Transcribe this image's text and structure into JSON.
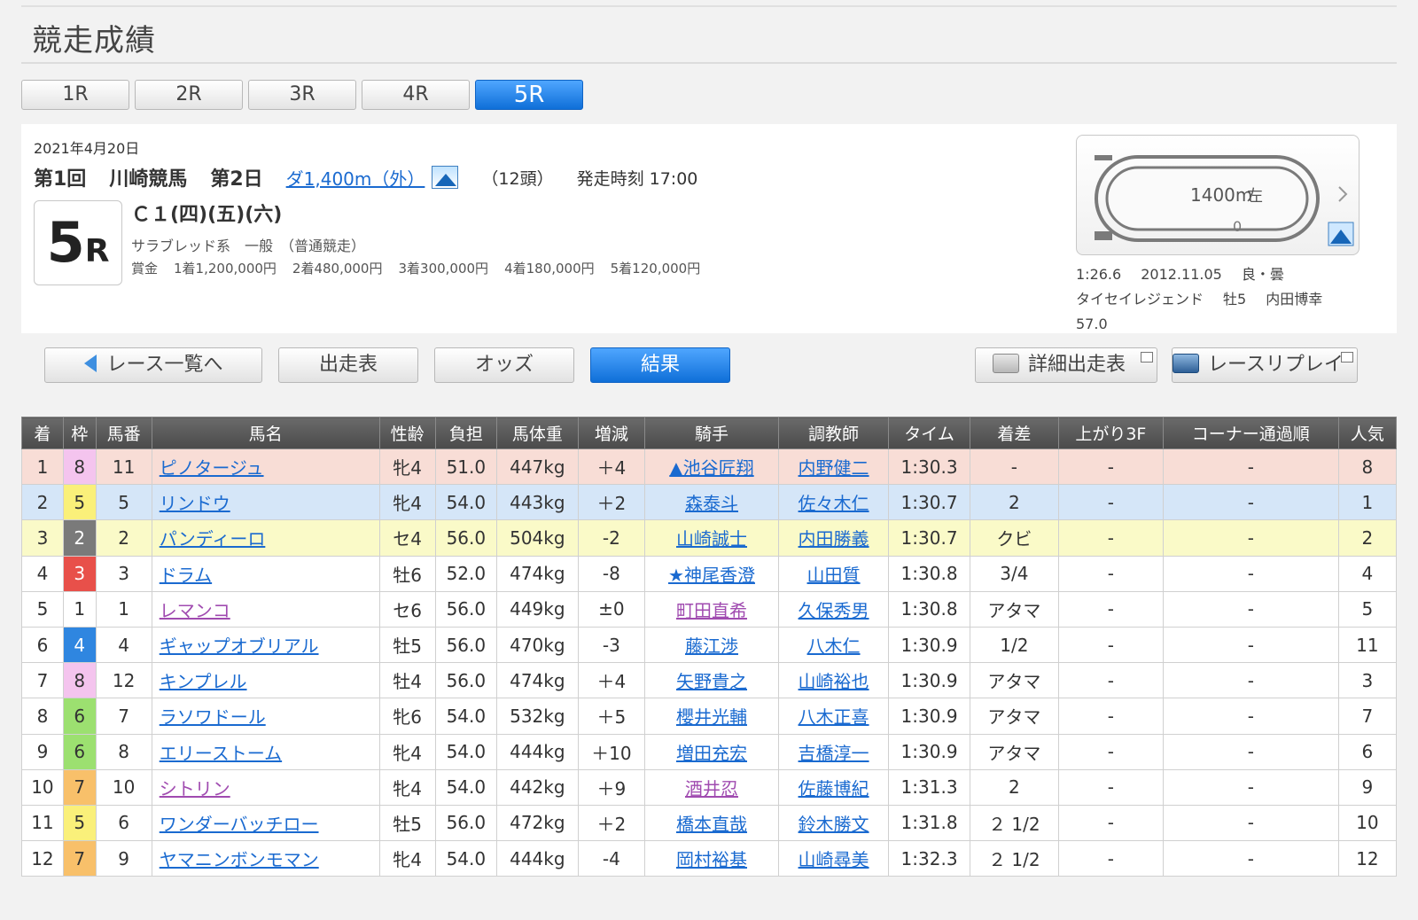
{
  "page": {
    "title": "競走成績"
  },
  "race_tabs": [
    {
      "label": "1R",
      "active": false
    },
    {
      "label": "2R",
      "active": false
    },
    {
      "label": "3R",
      "active": false
    },
    {
      "label": "4R",
      "active": false
    },
    {
      "label": "5R",
      "active": true
    }
  ],
  "race": {
    "date": "2021年4月20日",
    "kai": "第1回",
    "venue": "川崎競馬",
    "day": "第2日",
    "course": "ダ1,400m（外）",
    "heads": "（12頭）",
    "start_time": "発走時刻 17:00",
    "number": "5",
    "number_suffix": "R",
    "class": "Ｃ１(四)(五)(六)",
    "type": "サラブレッド系　一般　（普通競走）",
    "prize_label": "賞金",
    "prizes": [
      "1着1,200,000円",
      "2着480,000円",
      "3着300,000円",
      "4着180,000円",
      "5着120,000円"
    ]
  },
  "course_map": {
    "distance": "1400m",
    "direction": "左",
    "finish_marker": "0"
  },
  "record": {
    "time": "1:26.6",
    "date": "2012.11.05",
    "condition": "良・曇",
    "horse": "タイセイレジェンド",
    "sex_age": "牡5",
    "jockey": "内田博幸",
    "weight": "57.0"
  },
  "nav": {
    "back": "レース一覧へ",
    "entries": "出走表",
    "odds": "オッズ",
    "results": "結果",
    "detail": "詳細出走表",
    "replay": "レースリプレイ"
  },
  "table": {
    "headers": [
      "着",
      "枠",
      "馬番",
      "馬名",
      "性齢",
      "負担",
      "馬体重",
      "増減",
      "騎手",
      "調教師",
      "タイム",
      "着差",
      "上がり3F",
      "コーナー通過順",
      "人気"
    ],
    "waku_colors": {
      "1": {
        "bg": "#ffffff",
        "fg": "#333333"
      },
      "2": {
        "bg": "#7a7a7a",
        "fg": "#ffffff"
      },
      "3": {
        "bg": "#e8504a",
        "fg": "#ffffff"
      },
      "4": {
        "bg": "#2f86e0",
        "fg": "#ffffff"
      },
      "5": {
        "bg": "#faf07a",
        "fg": "#333333"
      },
      "6": {
        "bg": "#9ce070",
        "fg": "#333333"
      },
      "7": {
        "bg": "#f8c06a",
        "fg": "#333333"
      },
      "8": {
        "bg": "#f4c4ee",
        "fg": "#333333"
      }
    },
    "rows": [
      {
        "rank": "1",
        "waku": "8",
        "num": "11",
        "horse": "ピノタージュ",
        "horse_visited": false,
        "sex_age": "牝4",
        "weight": "51.0",
        "body": "447kg",
        "diff": "＋4",
        "jockey": "▲池谷匠翔",
        "trainer": "内野健二",
        "time": "1:30.3",
        "margin": "-",
        "last3f": "-",
        "corner": "-",
        "pop": "8"
      },
      {
        "rank": "2",
        "waku": "5",
        "num": "5",
        "horse": "リンドウ",
        "horse_visited": false,
        "sex_age": "牝4",
        "weight": "54.0",
        "body": "443kg",
        "diff": "＋2",
        "jockey": "森泰斗",
        "trainer": "佐々木仁",
        "time": "1:30.7",
        "margin": "2",
        "last3f": "-",
        "corner": "-",
        "pop": "1"
      },
      {
        "rank": "3",
        "waku": "2",
        "num": "2",
        "horse": "パンディーロ",
        "horse_visited": false,
        "sex_age": "セ4",
        "weight": "56.0",
        "body": "504kg",
        "diff": "-2",
        "jockey": "山崎誠士",
        "trainer": "内田勝義",
        "time": "1:30.7",
        "margin": "クビ",
        "last3f": "-",
        "corner": "-",
        "pop": "2"
      },
      {
        "rank": "4",
        "waku": "3",
        "num": "3",
        "horse": "ドラム",
        "horse_visited": false,
        "sex_age": "牡6",
        "weight": "52.0",
        "body": "474kg",
        "diff": "-8",
        "jockey": "★神尾香澄",
        "trainer": "山田質",
        "time": "1:30.8",
        "margin": "3/4",
        "last3f": "-",
        "corner": "-",
        "pop": "4"
      },
      {
        "rank": "5",
        "waku": "1",
        "num": "1",
        "horse": "レマンコ",
        "horse_visited": true,
        "sex_age": "セ6",
        "weight": "56.0",
        "body": "449kg",
        "diff": "±0",
        "jockey": "町田直希",
        "trainer": "久保秀男",
        "time": "1:30.8",
        "margin": "アタマ",
        "last3f": "-",
        "corner": "-",
        "pop": "5"
      },
      {
        "rank": "6",
        "waku": "4",
        "num": "4",
        "horse": "ギャップオブリアル",
        "horse_visited": false,
        "sex_age": "牡5",
        "weight": "56.0",
        "body": "470kg",
        "diff": "-3",
        "jockey": "藤江渉",
        "trainer": "八木仁",
        "time": "1:30.9",
        "margin": "1/2",
        "last3f": "-",
        "corner": "-",
        "pop": "11"
      },
      {
        "rank": "7",
        "waku": "8",
        "num": "12",
        "horse": "キンプレル",
        "horse_visited": false,
        "sex_age": "牡4",
        "weight": "56.0",
        "body": "474kg",
        "diff": "＋4",
        "jockey": "矢野貴之",
        "trainer": "山崎裕也",
        "time": "1:30.9",
        "margin": "アタマ",
        "last3f": "-",
        "corner": "-",
        "pop": "3"
      },
      {
        "rank": "8",
        "waku": "6",
        "num": "7",
        "horse": "ラソワドール",
        "horse_visited": false,
        "sex_age": "牝6",
        "weight": "54.0",
        "body": "532kg",
        "diff": "＋5",
        "jockey": "櫻井光輔",
        "trainer": "八木正喜",
        "time": "1:30.9",
        "margin": "アタマ",
        "last3f": "-",
        "corner": "-",
        "pop": "7"
      },
      {
        "rank": "9",
        "waku": "6",
        "num": "8",
        "horse": "エリーストーム",
        "horse_visited": false,
        "sex_age": "牝4",
        "weight": "54.0",
        "body": "444kg",
        "diff": "＋10",
        "jockey": "増田充宏",
        "trainer": "吉橋淳一",
        "time": "1:30.9",
        "margin": "アタマ",
        "last3f": "-",
        "corner": "-",
        "pop": "6"
      },
      {
        "rank": "10",
        "waku": "7",
        "num": "10",
        "horse": "シトリン",
        "horse_visited": true,
        "sex_age": "牝4",
        "weight": "54.0",
        "body": "442kg",
        "diff": "＋9",
        "jockey": "酒井忍",
        "trainer": "佐藤博紀",
        "time": "1:31.3",
        "margin": "2",
        "last3f": "-",
        "corner": "-",
        "pop": "9"
      },
      {
        "rank": "11",
        "waku": "5",
        "num": "6",
        "horse": "ワンダーバッチロー",
        "horse_visited": false,
        "sex_age": "牡5",
        "weight": "56.0",
        "body": "472kg",
        "diff": "＋2",
        "jockey": "橋本直哉",
        "trainer": "鈴木勝文",
        "time": "1:31.8",
        "margin": "２ 1/2",
        "last3f": "-",
        "corner": "-",
        "pop": "10"
      },
      {
        "rank": "12",
        "waku": "7",
        "num": "9",
        "horse": "ヤマニンボンモマン",
        "horse_visited": false,
        "sex_age": "牝4",
        "weight": "54.0",
        "body": "444kg",
        "diff": "-4",
        "jockey": "岡村裕基",
        "trainer": "山崎尋美",
        "time": "1:32.3",
        "margin": "２ 1/2",
        "last3f": "-",
        "corner": "-",
        "pop": "12"
      }
    ]
  }
}
